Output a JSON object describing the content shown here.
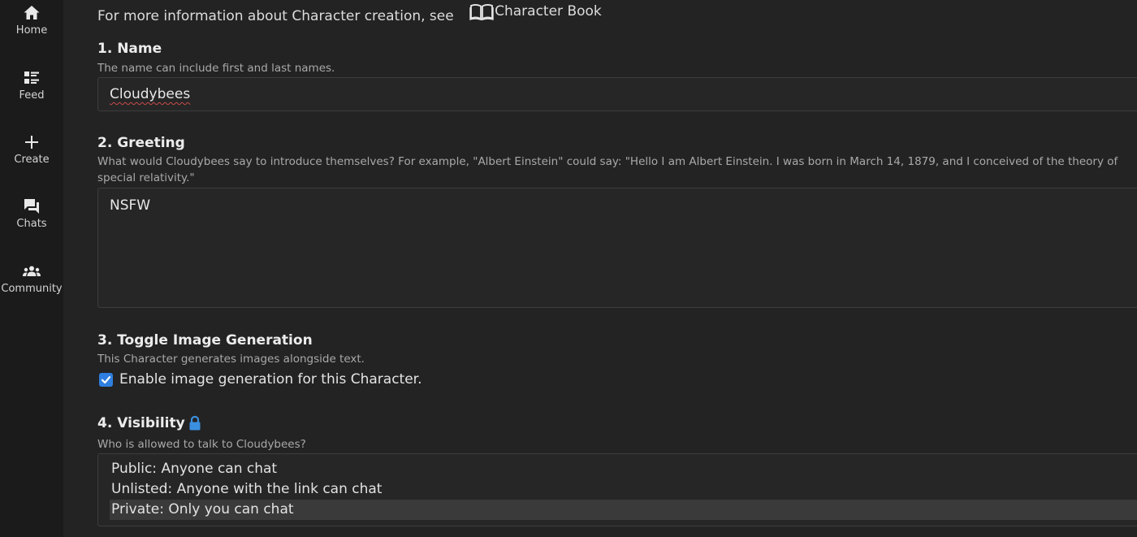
{
  "sidebar": {
    "items": [
      {
        "label": "Home",
        "icon": "home-icon"
      },
      {
        "label": "Feed",
        "icon": "feed-icon"
      },
      {
        "label": "Create",
        "icon": "plus-icon"
      },
      {
        "label": "Chats",
        "icon": "chat-icon"
      },
      {
        "label": "Community",
        "icon": "community-icon"
      }
    ]
  },
  "intro": {
    "text": "For more information about Character creation, see",
    "link_label": "Character Book",
    "link_icon": "book-icon"
  },
  "name_section": {
    "title": "1. Name",
    "help": "The name can include first and last names.",
    "value": "Cloudybees"
  },
  "greeting_section": {
    "title": "2. Greeting",
    "help": "What would Cloudybees say to introduce themselves? For example, \"Albert Einstein\" could say: \"Hello I am Albert Einstein. I was born in March 14, 1879, and I conceived of the theory of special relativity.\"",
    "value": "NSFW"
  },
  "image_section": {
    "title": "3. Toggle Image Generation",
    "help": "This Character generates images alongside text.",
    "checkbox_label": "Enable image generation for this Character.",
    "checked": true
  },
  "visibility_section": {
    "title": "4. Visibility",
    "title_icon": "lock-icon",
    "help": "Who is allowed to talk to Cloudybees?",
    "options": [
      "Public: Anyone can chat",
      "Unlisted: Anyone with the link can chat",
      "Private: Only you can chat"
    ],
    "selected": "Private: Only you can chat"
  },
  "colors": {
    "background": "#232323",
    "sidebar": "#1b1b1b",
    "accent": "#2f7fe0",
    "lock": "#3b8fe0"
  }
}
